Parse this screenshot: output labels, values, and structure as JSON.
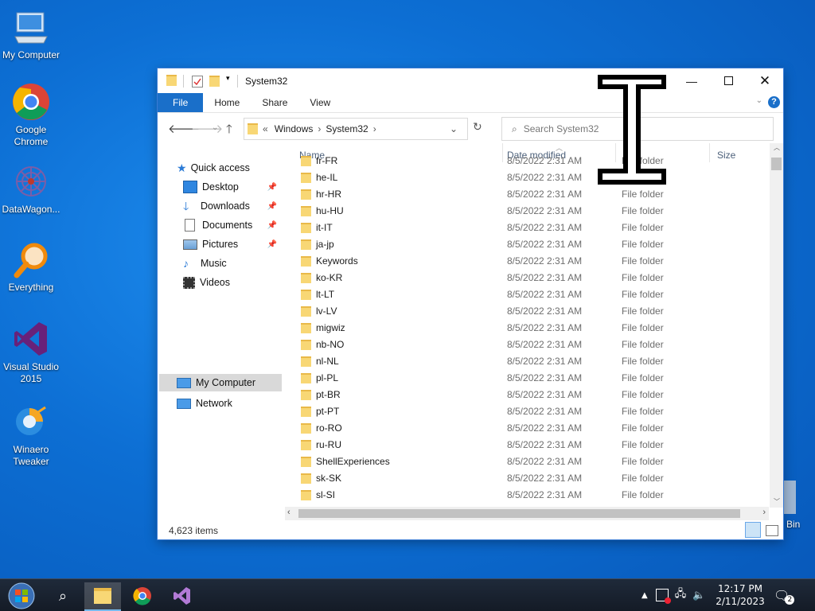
{
  "desktop": {
    "icons": [
      {
        "label": "My Computer",
        "icon": "monitor-icon"
      },
      {
        "label": "Google Chrome",
        "icon": "chrome-icon"
      },
      {
        "label": "DataWagon...",
        "icon": "datawagon-icon"
      },
      {
        "label": "Everything",
        "icon": "magnifier-icon"
      },
      {
        "label": "Visual Studio 2015",
        "icon": "visual-studio-icon"
      },
      {
        "label": "Winaero Tweaker",
        "icon": "winaero-icon"
      },
      {
        "label": "Bin",
        "icon": "recycle-bin-icon"
      }
    ]
  },
  "window": {
    "title": "System32",
    "ribbon_tabs": [
      "File",
      "Home",
      "Share",
      "View"
    ],
    "breadcrumb": {
      "prefix": "«",
      "parts": [
        "Windows",
        "System32"
      ]
    },
    "search_placeholder": "Search System32",
    "nav": {
      "quick_access": "Quick access",
      "items": [
        {
          "label": "Desktop",
          "pinned": true
        },
        {
          "label": "Downloads",
          "pinned": true
        },
        {
          "label": "Documents",
          "pinned": true
        },
        {
          "label": "Pictures",
          "pinned": true
        },
        {
          "label": "Music",
          "pinned": false
        },
        {
          "label": "Videos",
          "pinned": false
        }
      ],
      "my_computer": "My Computer",
      "network": "Network"
    },
    "columns": {
      "name": "Name",
      "date": "Date modified",
      "size": "Size"
    },
    "rows": [
      {
        "name": "fr-FR",
        "date": "8/5/2022 2:31 AM",
        "type": "File folder"
      },
      {
        "name": "he-IL",
        "date": "8/5/2022 2:31 AM",
        "type": "File folder"
      },
      {
        "name": "hr-HR",
        "date": "8/5/2022 2:31 AM",
        "type": "File folder"
      },
      {
        "name": "hu-HU",
        "date": "8/5/2022 2:31 AM",
        "type": "File folder"
      },
      {
        "name": "it-IT",
        "date": "8/5/2022 2:31 AM",
        "type": "File folder"
      },
      {
        "name": "ja-jp",
        "date": "8/5/2022 2:31 AM",
        "type": "File folder"
      },
      {
        "name": "Keywords",
        "date": "8/5/2022 2:31 AM",
        "type": "File folder"
      },
      {
        "name": "ko-KR",
        "date": "8/5/2022 2:31 AM",
        "type": "File folder"
      },
      {
        "name": "lt-LT",
        "date": "8/5/2022 2:31 AM",
        "type": "File folder"
      },
      {
        "name": "lv-LV",
        "date": "8/5/2022 2:31 AM",
        "type": "File folder"
      },
      {
        "name": "migwiz",
        "date": "8/5/2022 2:31 AM",
        "type": "File folder"
      },
      {
        "name": "nb-NO",
        "date": "8/5/2022 2:31 AM",
        "type": "File folder"
      },
      {
        "name": "nl-NL",
        "date": "8/5/2022 2:31 AM",
        "type": "File folder"
      },
      {
        "name": "pl-PL",
        "date": "8/5/2022 2:31 AM",
        "type": "File folder"
      },
      {
        "name": "pt-BR",
        "date": "8/5/2022 2:31 AM",
        "type": "File folder"
      },
      {
        "name": "pt-PT",
        "date": "8/5/2022 2:31 AM",
        "type": "File folder"
      },
      {
        "name": "ro-RO",
        "date": "8/5/2022 2:31 AM",
        "type": "File folder"
      },
      {
        "name": "ru-RU",
        "date": "8/5/2022 2:31 AM",
        "type": "File folder"
      },
      {
        "name": "ShellExperiences",
        "date": "8/5/2022 2:31 AM",
        "type": "File folder"
      },
      {
        "name": "sk-SK",
        "date": "8/5/2022 2:31 AM",
        "type": "File folder"
      },
      {
        "name": "sl-SI",
        "date": "8/5/2022 2:31 AM",
        "type": "File folder"
      }
    ],
    "status": "4,623 items"
  },
  "taskbar": {
    "apps": [
      "start-orb-icon",
      "search-icon",
      "file-explorer-icon",
      "chrome-icon",
      "visual-studio-icon"
    ],
    "time": "12:17 PM",
    "date": "2/11/2023",
    "notification_count": "2"
  },
  "colors": {
    "accent": "#1a6fc9",
    "selection": "#cce4f7",
    "folder": "#f8d775"
  }
}
